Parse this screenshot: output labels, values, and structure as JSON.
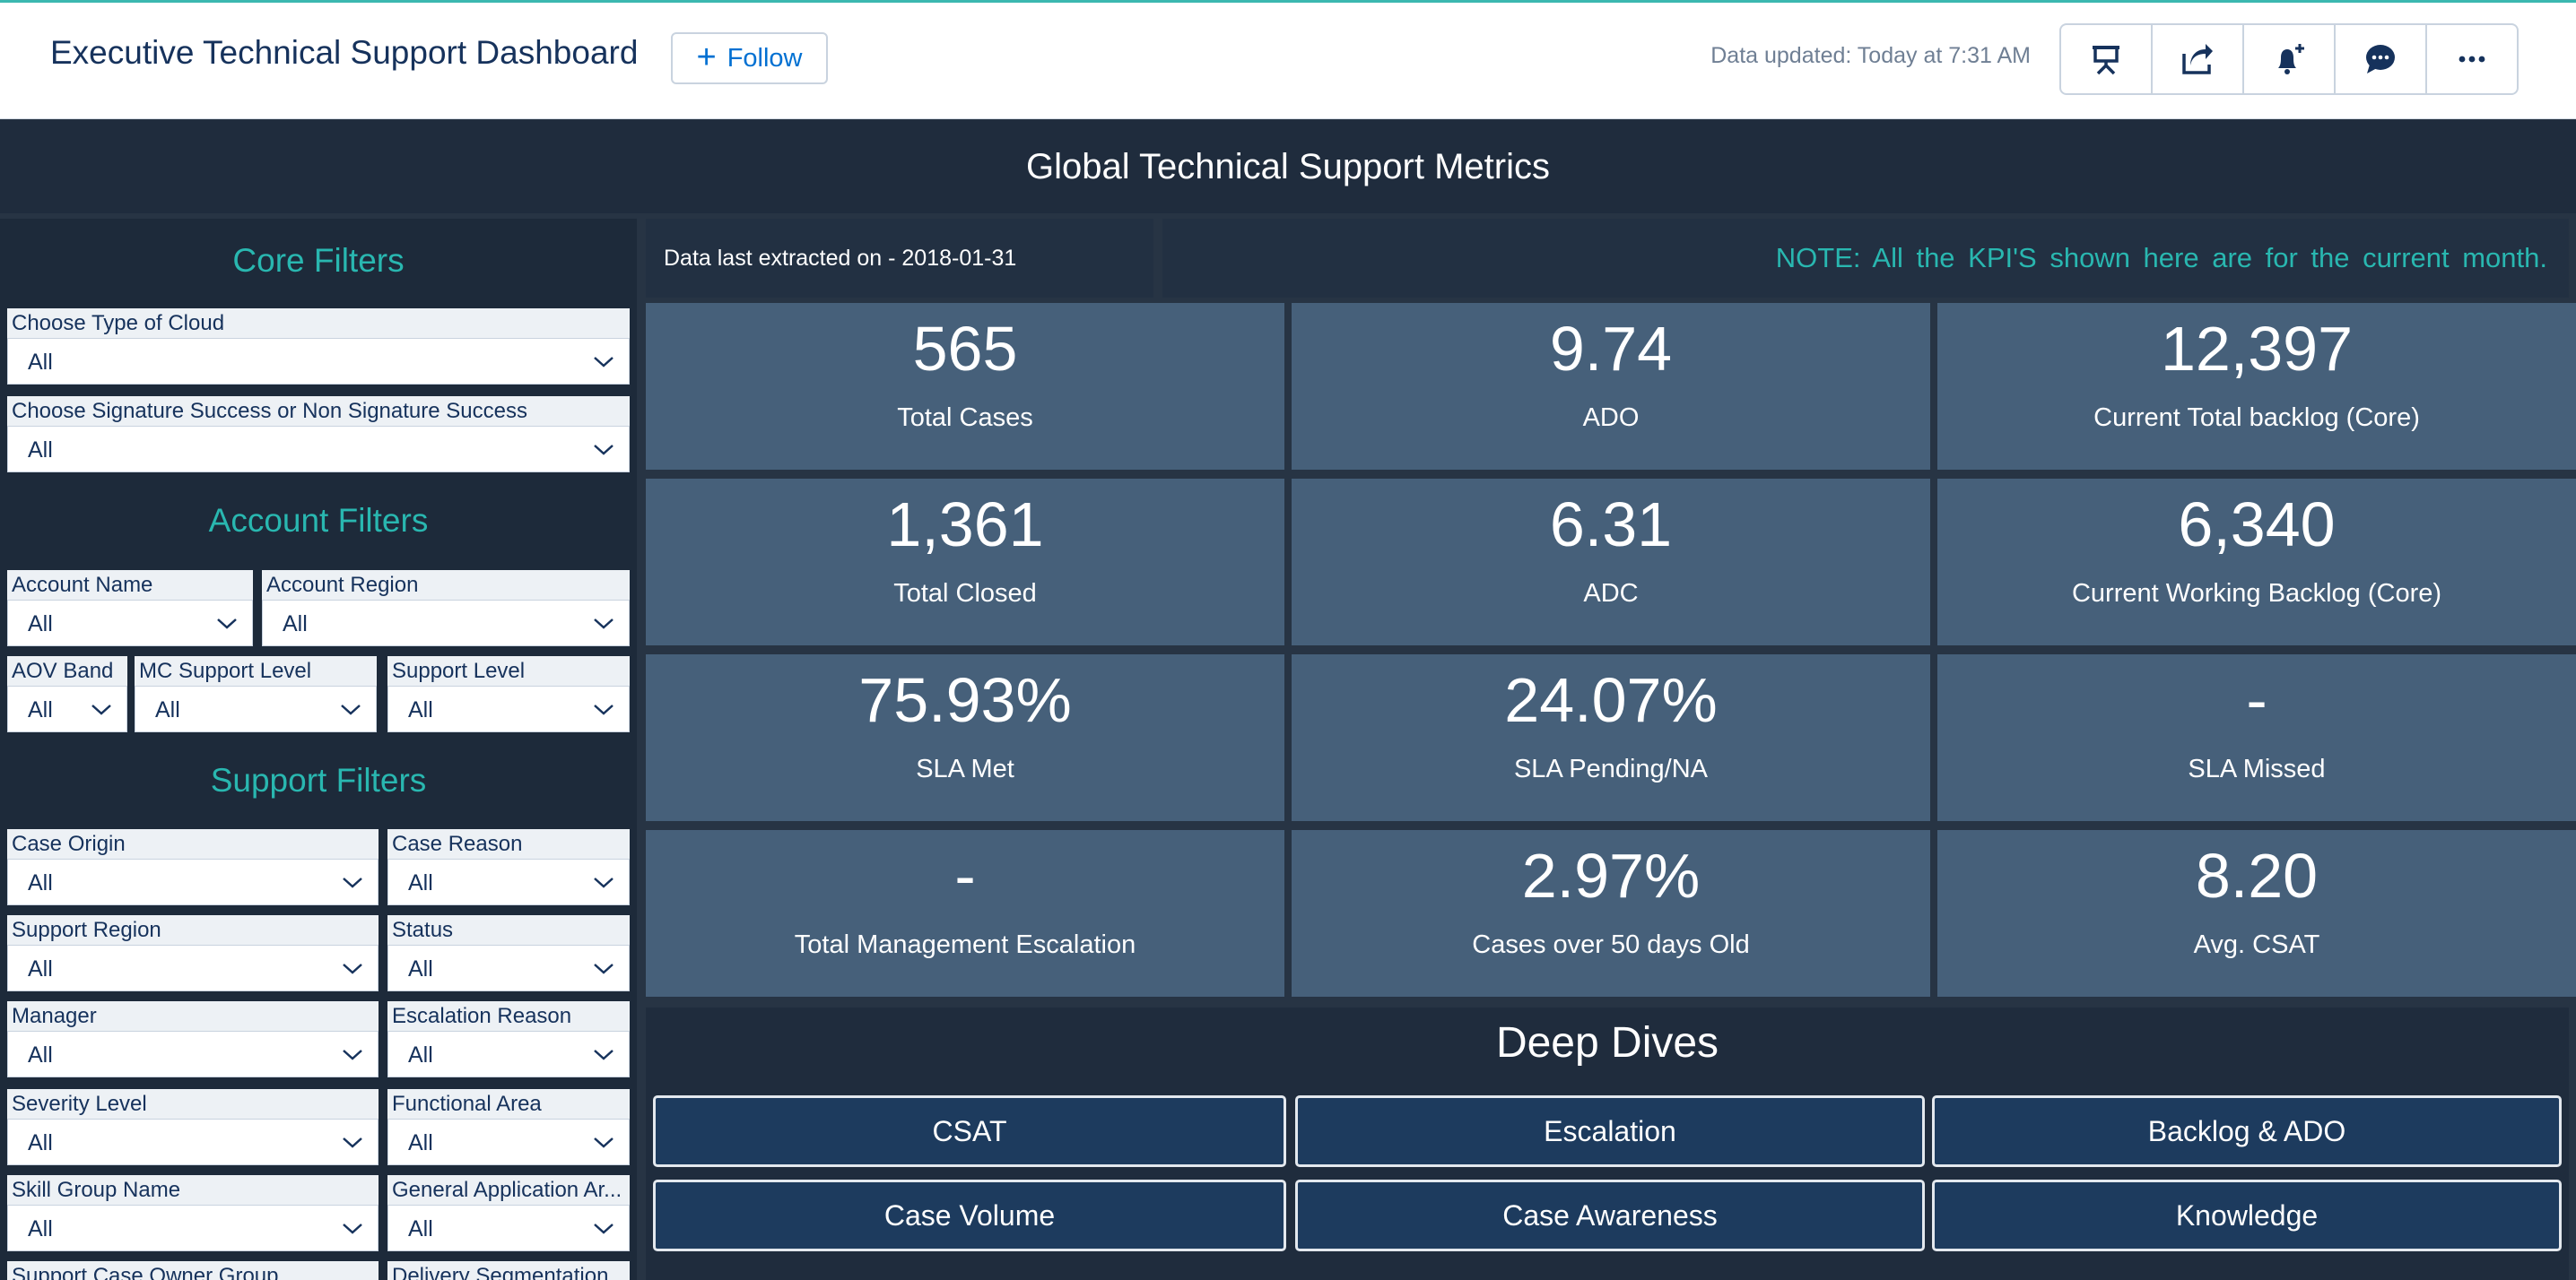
{
  "header": {
    "title": "Executive Technical Support Dashboard",
    "follow_label": "Follow",
    "updated_text": "Data updated: Today at 7:31 AM",
    "icons": [
      "presentation-icon",
      "share-icon",
      "notification-add-icon",
      "comment-icon",
      "more-icon"
    ]
  },
  "band": {
    "title": "Global Technical Support Metrics"
  },
  "filters": {
    "core_title": "Core Filters",
    "account_title": "Account Filters",
    "support_title": "Support  Filters",
    "cloud": {
      "label": "Choose Type of Cloud",
      "value": "All"
    },
    "signature": {
      "label": "Choose Signature Success or Non Signature Success",
      "value": "All"
    },
    "account_name": {
      "label": "Account Name",
      "value": "All"
    },
    "account_region": {
      "label": "Account Region",
      "value": "All"
    },
    "aov_band": {
      "label": "AOV Band",
      "value": "All"
    },
    "mc_support_level": {
      "label": "MC Support Level",
      "value": "All"
    },
    "support_level": {
      "label": "Support Level",
      "value": "All"
    },
    "case_origin": {
      "label": "Case Origin",
      "value": "All"
    },
    "case_reason": {
      "label": "Case Reason",
      "value": "All"
    },
    "support_region": {
      "label": "Support Region",
      "value": "All"
    },
    "status": {
      "label": "Status",
      "value": "All"
    },
    "manager": {
      "label": "Manager",
      "value": "All"
    },
    "escalation_reason": {
      "label": "Escalation Reason",
      "value": "All"
    },
    "severity_level": {
      "label": "Severity Level",
      "value": "All"
    },
    "functional_area": {
      "label": "Functional Area",
      "value": "All"
    },
    "skill_group": {
      "label": "Skill Group Name",
      "value": "All"
    },
    "general_app_area": {
      "label": "General Application Ar...",
      "value": "All"
    },
    "owner_group": {
      "label": "Support Case Owner Group"
    },
    "delivery_segmentation": {
      "label": "Delivery Segmentation"
    }
  },
  "info": {
    "extracted": "Data last extracted on - 2018-01-31",
    "note": "NOTE: All  the  KPI'S  shown  here  are  for the current month."
  },
  "kpis": [
    {
      "value": "565",
      "label": "Total Cases"
    },
    {
      "value": "9.74",
      "label": "ADO"
    },
    {
      "value": "12,397",
      "label": "Current Total backlog (Core)"
    },
    {
      "value": "1,361",
      "label": "Total Closed"
    },
    {
      "value": "6.31",
      "label": "ADC"
    },
    {
      "value": "6,340",
      "label": "Current Working Backlog (Core)"
    },
    {
      "value": "75.93%",
      "label": "SLA Met"
    },
    {
      "value": "24.07%",
      "label": "SLA Pending/NA"
    },
    {
      "value": "-",
      "label": "SLA Missed"
    },
    {
      "value": "-",
      "label": "Total Management Escalation"
    },
    {
      "value": "2.97%",
      "label": "Cases over 50 days Old"
    },
    {
      "value": "8.20",
      "label": "Avg. CSAT"
    }
  ],
  "deep_dives": {
    "title": "Deep Dives",
    "buttons": [
      "CSAT",
      "Escalation",
      "Backlog & ADO",
      "Case Volume",
      "Case Awareness",
      "Knowledge"
    ]
  }
}
